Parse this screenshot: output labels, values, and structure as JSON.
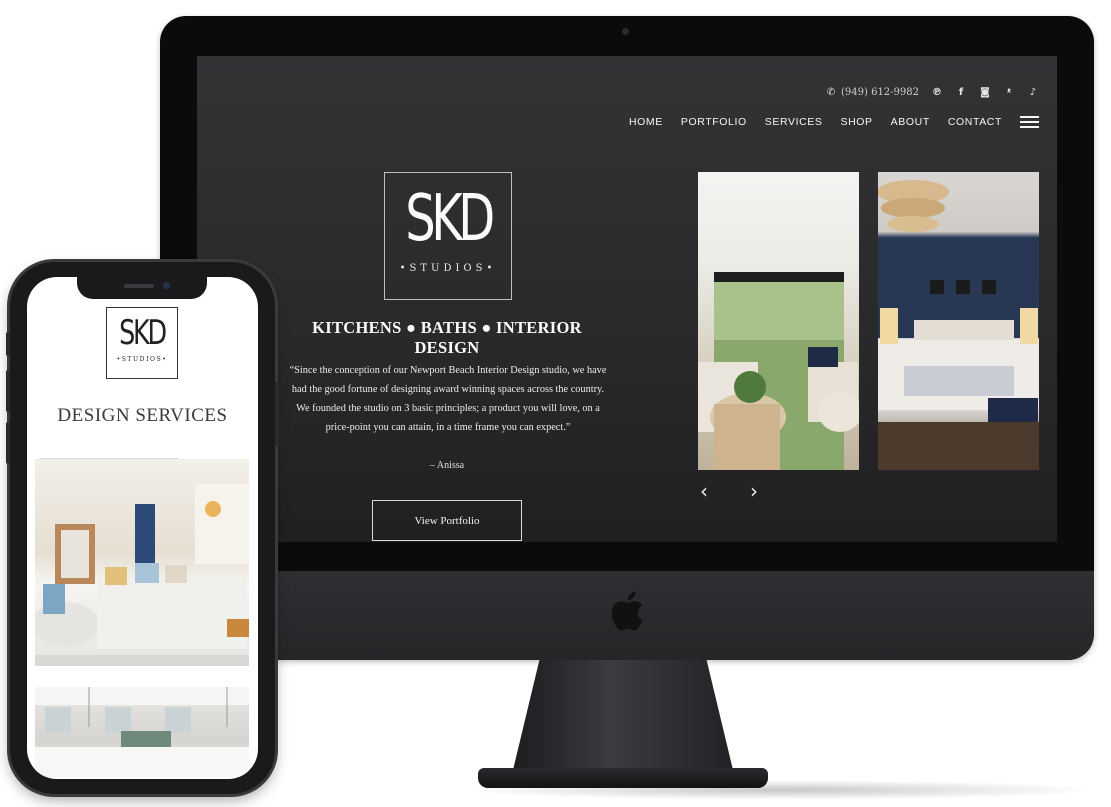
{
  "desktop": {
    "phone": "(949) 612-9982",
    "social_icons": [
      "pinterest-icon",
      "facebook-icon",
      "instagram-icon",
      "twitter-icon",
      "tiktok-icon"
    ],
    "nav": [
      "HOME",
      "PORTFOLIO",
      "SERVICES",
      "SHOP",
      "ABOUT",
      "CONTACT"
    ],
    "logo": {
      "mark": "SKD",
      "sub": "•STUDIOS•"
    },
    "tagline": "KITCHENS ● BATHS ● INTERIOR DESIGN",
    "quote": "“Since the conception of our Newport Beach Interior Design studio, we have had the good fortune of designing award winning spaces across the country. We founded the studio on 3 basic principles; a product you will love, on a price-point you can attain, in a time frame you can expect.”",
    "author": "– Anissa",
    "button": "View Portfolio",
    "slider": {
      "prev_icon": "‹",
      "next_icon": "›"
    }
  },
  "mobile": {
    "logo": {
      "mark": "SKD",
      "sub": "•STUDIOS•"
    },
    "heading": "DESIGN SERVICES"
  },
  "colors": {
    "screen_bg": "#2b2b2d",
    "device_frame": "#0b0b0c",
    "navy_accent": "#243350"
  }
}
